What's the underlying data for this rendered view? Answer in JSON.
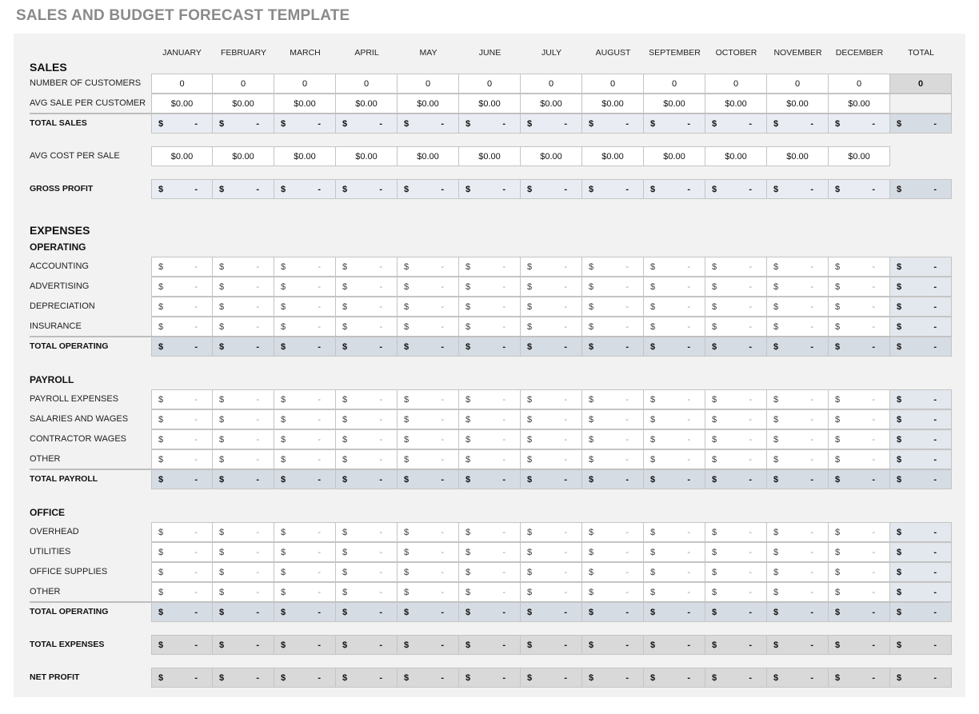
{
  "title": "SALES AND BUDGET FORECAST TEMPLATE",
  "months": [
    "JANUARY",
    "FEBRUARY",
    "MARCH",
    "APRIL",
    "MAY",
    "JUNE",
    "JULY",
    "AUGUST",
    "SEPTEMBER",
    "OCTOBER",
    "NOVEMBER",
    "DECEMBER"
  ],
  "total_header": "TOTAL",
  "currency_symbol": "$",
  "empty_value": "-",
  "sales": {
    "heading": "SALES",
    "customers_label": "NUMBER OF CUSTOMERS",
    "customers": [
      "0",
      "0",
      "0",
      "0",
      "0",
      "0",
      "0",
      "0",
      "0",
      "0",
      "0",
      "0"
    ],
    "customers_total": "0",
    "avg_sale_label": "AVG SALE PER CUSTOMER",
    "avg_sale": [
      "$0.00",
      "$0.00",
      "$0.00",
      "$0.00",
      "$0.00",
      "$0.00",
      "$0.00",
      "$0.00",
      "$0.00",
      "$0.00",
      "$0.00",
      "$0.00"
    ],
    "total_sales_label": "TOTAL SALES",
    "avg_cost_label": "AVG COST PER SALE",
    "avg_cost": [
      "$0.00",
      "$0.00",
      "$0.00",
      "$0.00",
      "$0.00",
      "$0.00",
      "$0.00",
      "$0.00",
      "$0.00",
      "$0.00",
      "$0.00",
      "$0.00"
    ],
    "gross_profit_label": "GROSS PROFIT"
  },
  "expenses": {
    "heading": "EXPENSES",
    "operating": {
      "heading": "OPERATING",
      "items": [
        "ACCOUNTING",
        "ADVERTISING",
        "DEPRECIATION",
        "INSURANCE"
      ],
      "total_label": "TOTAL OPERATING"
    },
    "payroll": {
      "heading": "PAYROLL",
      "items": [
        "PAYROLL EXPENSES",
        "SALARIES AND WAGES",
        "CONTRACTOR WAGES",
        "OTHER"
      ],
      "total_label": "TOTAL PAYROLL"
    },
    "office": {
      "heading": "OFFICE",
      "items": [
        "OVERHEAD",
        "UTILITIES",
        "OFFICE SUPPLIES",
        "OTHER"
      ],
      "total_label": "TOTAL OPERATING"
    },
    "total_expenses_label": "TOTAL EXPENSES",
    "net_profit_label": "NET PROFIT"
  },
  "colors": {
    "panel_bg": "#f2f2f2",
    "calc_row_bg": "#e9edf3",
    "subtotal_row_bg": "#d6dce4",
    "grand_total_bg": "#d9d9d9",
    "title_color": "#8a8a8a"
  }
}
